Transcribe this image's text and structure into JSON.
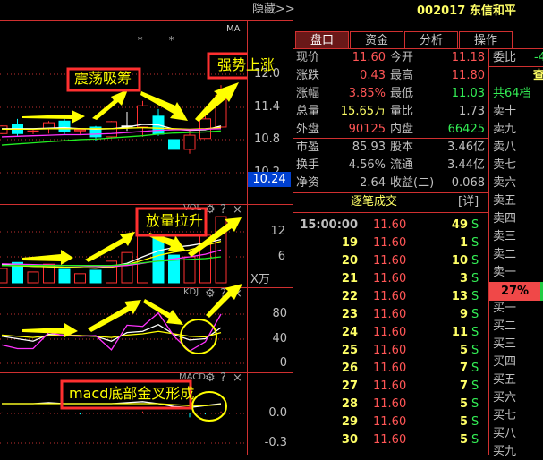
{
  "left": {
    "hide_button": "隐藏>>",
    "main_indicator": "MA",
    "price_axis": [
      "12.0",
      "11.4",
      "10.8",
      "10.2"
    ],
    "current_price_tag": "10.24",
    "vol_label": "VOL",
    "vol_axis": [
      "12",
      "6"
    ],
    "vol_unit": "X万",
    "kdj_label": "KDJ",
    "kdj_axis": [
      "80",
      "40",
      "0"
    ],
    "macd_label": "MACD",
    "macd_axis": [
      "0.0",
      "-0.3"
    ],
    "pane_icons": [
      "gear-icon",
      "help-icon",
      "close-icon"
    ],
    "help_glyph": "?",
    "close_glyph": "×",
    "annotations": {
      "accumulate": "震荡吸筹",
      "strong_rise": "强势上涨",
      "volume_up": "放量拉升",
      "macd_cross": "macd底部金叉形成"
    }
  },
  "chart_data": {
    "type": "candlestick",
    "price_range": [
      10.2,
      12.0
    ],
    "candles": [
      {
        "o": 10.91,
        "c": 11.05,
        "h": 11.06,
        "l": 10.9
      },
      {
        "o": 11.08,
        "c": 10.91,
        "h": 11.18,
        "l": 10.87
      },
      {
        "o": 10.95,
        "c": 10.96,
        "h": 11.0,
        "l": 10.9
      },
      {
        "o": 11.0,
        "c": 11.11,
        "h": 11.14,
        "l": 10.91
      },
      {
        "o": 11.14,
        "c": 10.95,
        "h": 11.18,
        "l": 10.9
      },
      {
        "o": 10.96,
        "c": 10.98,
        "h": 11.01,
        "l": 10.9
      },
      {
        "o": 11.03,
        "c": 10.85,
        "h": 11.05,
        "l": 10.78
      },
      {
        "o": 10.85,
        "c": 11.13,
        "h": 11.14,
        "l": 10.82
      },
      {
        "o": 11.04,
        "c": 11.05,
        "h": 11.31,
        "l": 10.96
      },
      {
        "o": 11.03,
        "c": 11.42,
        "h": 11.51,
        "l": 10.85
      },
      {
        "o": 11.23,
        "c": 10.9,
        "h": 11.36,
        "l": 10.87
      },
      {
        "o": 10.8,
        "c": 10.62,
        "h": 10.88,
        "l": 10.49
      },
      {
        "o": 10.62,
        "c": 10.88,
        "h": 10.98,
        "l": 10.54
      },
      {
        "o": 10.82,
        "c": 11.18,
        "h": 11.28,
        "l": 10.82
      },
      {
        "o": 11.03,
        "c": 11.61,
        "h": 11.8,
        "l": 11.03
      }
    ],
    "ma": [
      {
        "name": "MA5",
        "color": "#ffffff",
        "values": [
          11.0,
          11.0,
          11.0,
          11.01,
          11.02,
          11.0,
          10.99,
          11.0,
          11.03,
          11.08,
          11.07,
          10.99,
          10.97,
          10.98,
          11.05
        ]
      },
      {
        "name": "MA10",
        "color": "#ffff00",
        "values": [
          10.99,
          10.99,
          10.99,
          11.0,
          11.0,
          11.0,
          11.0,
          11.0,
          11.01,
          11.02,
          11.01,
          11.0,
          10.99,
          11.0,
          11.02
        ]
      },
      {
        "name": "MA20",
        "color": "#ff33ff",
        "values": [
          10.85,
          10.86,
          10.87,
          10.88,
          10.89,
          10.89,
          10.9,
          10.91,
          10.93,
          10.95,
          10.97,
          10.98,
          10.98,
          10.99,
          11.0
        ]
      },
      {
        "name": "MA60",
        "color": "#22ee22",
        "values": [
          10.7,
          10.72,
          10.74,
          10.76,
          10.78,
          10.8,
          10.81,
          10.83,
          10.85,
          10.87,
          10.9,
          10.92,
          10.93,
          10.94,
          10.96
        ]
      }
    ],
    "volume": [
      3.3,
      4.7,
      2.5,
      4.3,
      3.1,
      2.1,
      2.9,
      5.0,
      7.0,
      11.2,
      11.2,
      6.4,
      6.0,
      11.0,
      15.3
    ],
    "volume_ma": [
      {
        "color": "#ffffff",
        "values": [
          4.2,
          4.0,
          3.8,
          3.7,
          3.6,
          3.5,
          3.4,
          3.8,
          4.5,
          6.0,
          7.4,
          8.2,
          8.6,
          9.2,
          10.0
        ]
      },
      {
        "color": "#ffff00",
        "values": [
          4.0,
          3.9,
          3.8,
          3.7,
          3.6,
          3.5,
          3.4,
          3.6,
          4.2,
          5.2,
          6.3,
          7.1,
          7.6,
          8.6,
          9.6
        ]
      },
      {
        "color": "#ff33ff",
        "values": [
          4.4,
          4.3,
          4.2,
          4.1,
          4.0,
          3.9,
          3.8,
          3.8,
          4.0,
          4.5,
          5.1,
          5.5,
          6.0,
          6.6,
          7.6
        ]
      },
      {
        "color": "#22ee22",
        "values": [
          4.0,
          4.0,
          4.0,
          4.0,
          4.0,
          4.0,
          4.0,
          4.0,
          4.3,
          4.6,
          5.0,
          5.2,
          5.4,
          5.6,
          6.0
        ]
      }
    ],
    "kdj": [
      {
        "name": "K",
        "color": "#ffffff",
        "values": [
          44,
          40,
          36,
          47,
          46,
          45,
          44,
          36,
          50,
          52,
          63,
          47,
          38,
          40,
          58
        ]
      },
      {
        "name": "D",
        "color": "#ffff00",
        "values": [
          46,
          44,
          42,
          45,
          46,
          45,
          44,
          42,
          46,
          48,
          52,
          48,
          44,
          43,
          50
        ]
      },
      {
        "name": "J",
        "color": "#ff33ff",
        "values": [
          30,
          24,
          24,
          50,
          45,
          44,
          45,
          22,
          62,
          60,
          82,
          44,
          20,
          35,
          80
        ]
      }
    ],
    "macd": [
      {
        "name": "DIF",
        "color": "#ffffff",
        "values": [
          0.1,
          0.1,
          0.1,
          0.11,
          0.1,
          0.1,
          0.1,
          0.1,
          0.11,
          0.12,
          0.1,
          0.07,
          0.06,
          0.08,
          0.1
        ]
      },
      {
        "name": "DEA",
        "color": "#ffff00",
        "values": [
          0.1,
          0.1,
          0.1,
          0.1,
          0.1,
          0.1,
          0.1,
          0.1,
          0.1,
          0.1,
          0.1,
          0.09,
          0.08,
          0.08,
          0.09
        ]
      }
    ],
    "macd_hist": [
      0.01,
      0,
      0.01,
      0.01,
      0,
      -0.01,
      0,
      0,
      0.01,
      0.02,
      0,
      -0.04,
      -0.04,
      -0.01,
      0.02
    ]
  },
  "right": {
    "stock_code": "002017",
    "stock_name": "东信和平",
    "tabs": [
      "盘口",
      "资金",
      "分析",
      "操作"
    ],
    "quote": [
      {
        "l1": "现价",
        "v1": "11.60",
        "c1": "red",
        "l2": "今开",
        "v2": "11.18",
        "c2": "red"
      },
      {
        "l1": "涨跌",
        "v1": "0.43",
        "c1": "red",
        "l2": "最高",
        "v2": "11.80",
        "c2": "red"
      },
      {
        "l1": "涨幅",
        "v1": "3.85%",
        "c1": "red",
        "l2": "最低",
        "v2": "11.03",
        "c2": "green"
      },
      {
        "l1": "总量",
        "v1": "15.65万",
        "c1": "yellow",
        "l2": "量比",
        "v2": "1.73",
        "c2": "gray"
      },
      {
        "l1": "外盘",
        "v1": "90125",
        "c1": "red",
        "l2": "内盘",
        "v2": "66425",
        "c2": "green"
      }
    ],
    "fundamentals": [
      {
        "l1": "市盈",
        "v1": "85.93",
        "l2": "股本",
        "v2": "3.46亿"
      },
      {
        "l1": "换手",
        "v1": "4.56%",
        "l2": "流通",
        "v2": "3.44亿"
      },
      {
        "l1": "净资",
        "v1": "2.64",
        "l2": "收益(二)",
        "v2": "0.068"
      }
    ],
    "ticks_title": "逐笔成交",
    "ticks_detail": "[详]",
    "ticks": [
      {
        "time": "15:00:00",
        "price": "11.60",
        "vol": "49",
        "side": "S"
      },
      {
        "time": "19",
        "price": "11.60",
        "vol": "1",
        "side": "S"
      },
      {
        "time": "20",
        "price": "11.60",
        "vol": "10",
        "side": "S"
      },
      {
        "time": "21",
        "price": "11.60",
        "vol": "3",
        "side": "S"
      },
      {
        "time": "22",
        "price": "11.60",
        "vol": "13",
        "side": "S"
      },
      {
        "time": "23",
        "price": "11.60",
        "vol": "9",
        "side": "S"
      },
      {
        "time": "24",
        "price": "11.60",
        "vol": "11",
        "side": "S"
      },
      {
        "time": "25",
        "price": "11.60",
        "vol": "5",
        "side": "S"
      },
      {
        "time": "26",
        "price": "11.60",
        "vol": "7",
        "side": "S"
      },
      {
        "time": "27",
        "price": "11.60",
        "vol": "7",
        "side": "S"
      },
      {
        "time": "28",
        "price": "11.60",
        "vol": "5",
        "side": "S"
      },
      {
        "time": "29",
        "price": "11.60",
        "vol": "5",
        "side": "S"
      },
      {
        "time": "30",
        "price": "11.60",
        "vol": "5",
        "side": "S"
      }
    ],
    "order_book": {
      "weibi_label": "委比",
      "weibi_value": "-4",
      "query": "查",
      "levels_count": "共64档",
      "sells": [
        "卖十",
        "卖九",
        "卖八",
        "卖七",
        "卖六",
        "卖五",
        "卖四",
        "卖三",
        "卖二",
        "卖一"
      ],
      "ratio": "27%",
      "buys": [
        "买一",
        "买二",
        "买三",
        "买四",
        "买五",
        "买六",
        "买七",
        "买八",
        "买九"
      ]
    }
  }
}
